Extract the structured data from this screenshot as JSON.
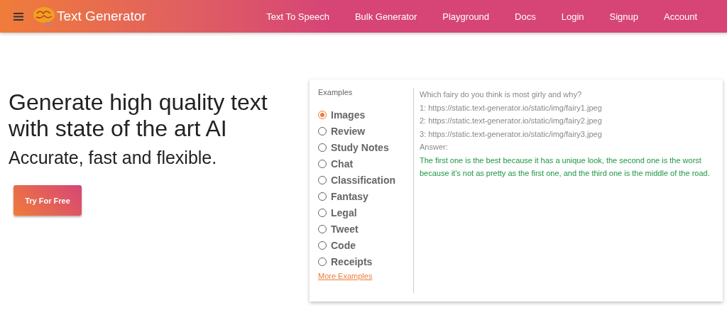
{
  "header": {
    "brand": "Text Generator",
    "nav": [
      "Text To Speech",
      "Bulk Generator",
      "Playground",
      "Docs",
      "Login",
      "Signup",
      "Account"
    ]
  },
  "hero": {
    "title": "Generate high quality text with state of the art AI",
    "subtitle": "Accurate, fast and flexible.",
    "cta": "Try For Free"
  },
  "examples": {
    "heading": "Examples",
    "options": [
      {
        "label": "Images",
        "selected": true
      },
      {
        "label": "Review",
        "selected": false
      },
      {
        "label": "Study Notes",
        "selected": false
      },
      {
        "label": "Chat",
        "selected": false
      },
      {
        "label": "Classification",
        "selected": false
      },
      {
        "label": "Fantasy",
        "selected": false
      },
      {
        "label": "Legal",
        "selected": false
      },
      {
        "label": "Tweet",
        "selected": false
      },
      {
        "label": "Code",
        "selected": false
      },
      {
        "label": "Receipts",
        "selected": false
      }
    ],
    "more_link": "More Examples",
    "prompt_lines": [
      "Which fairy do you think is most girly and why?",
      "1: https://static.text-generator.io/static/img/fairy1.jpeg",
      "2: https://static.text-generator.io/static/img/fairy2.jpeg",
      "3: https://static.text-generator.io/static/img/fairy3.jpeg",
      "Answer:"
    ],
    "answer": "The first one is the best because it has a unique look, the second one is the worst because it's not as pretty as the first one, and the third one is the middle of the road."
  }
}
